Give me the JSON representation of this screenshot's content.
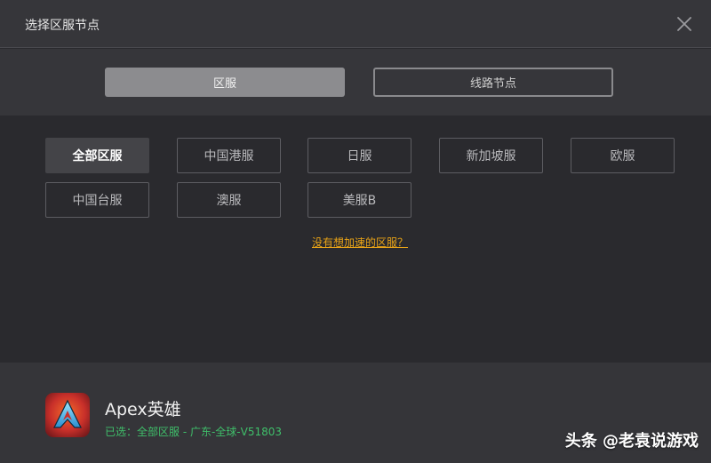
{
  "window": {
    "title": "选择区服节点",
    "close_icon": "close-icon"
  },
  "tabs": [
    {
      "label": "区服",
      "active": true
    },
    {
      "label": "线路节点",
      "active": false
    }
  ],
  "regions": [
    {
      "label": "全部区服",
      "selected": true
    },
    {
      "label": "中国港服",
      "selected": false
    },
    {
      "label": "日服",
      "selected": false
    },
    {
      "label": "新加坡服",
      "selected": false
    },
    {
      "label": "欧服",
      "selected": false
    },
    {
      "label": "中国台服",
      "selected": false
    },
    {
      "label": "澳服",
      "selected": false
    },
    {
      "label": "美服B",
      "selected": false
    }
  ],
  "help_link": "没有想加速的区服？",
  "game": {
    "name": "Apex英雄",
    "selected_info": "已选：全部区服 - 广东-全球-V51803",
    "logo_icon": "apex-logo-icon"
  },
  "watermark": "头条 @老袁说游戏",
  "colors": {
    "accent_link": "#e8a317",
    "selected_text": "#3fbf6a",
    "active_tab": "#8c8c8f"
  }
}
